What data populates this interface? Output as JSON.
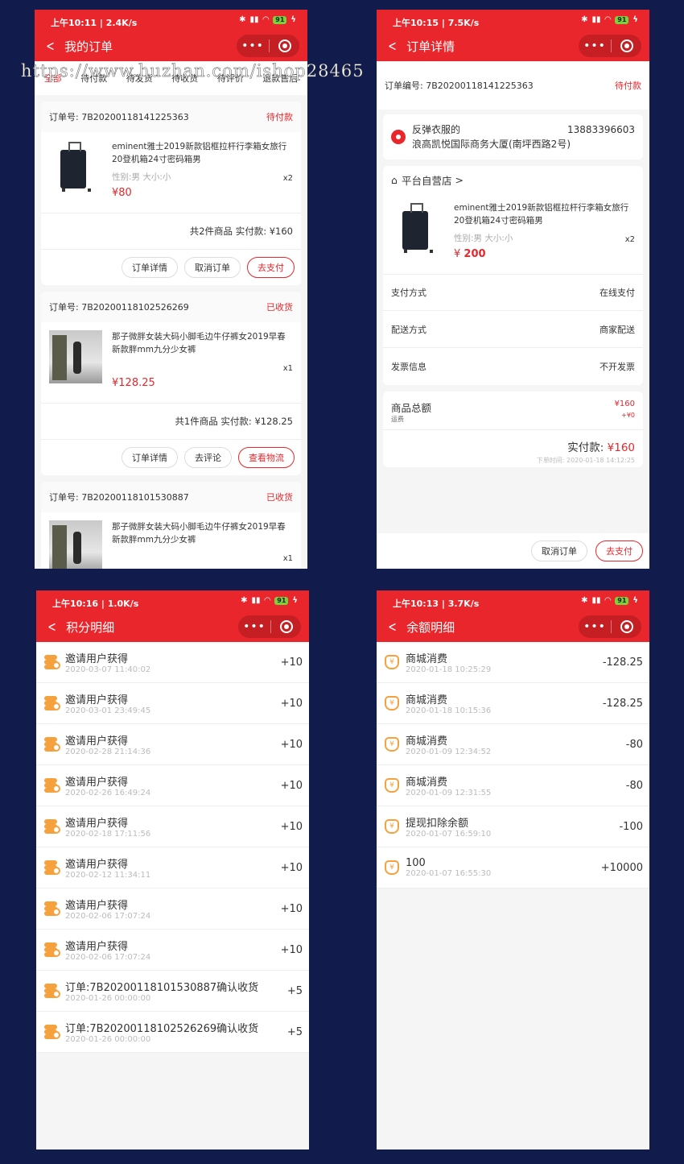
{
  "watermark": "https://www.huzhan.com/ishop28465",
  "colors": {
    "accent": "#e9262b",
    "background": "#111c4d",
    "coin": "#f5a13d"
  },
  "p1": {
    "status": {
      "time": "上午10:11 | 2.4K/s",
      "battery": "91"
    },
    "title": "我的订单",
    "tabs": [
      "全部",
      "待付款",
      "待发货",
      "待收货",
      "待评价",
      "退款售后"
    ],
    "orders": [
      {
        "no_label": "订单号:",
        "no": "7B20200118141225363",
        "status": "待付款",
        "name": "eminent雅士2019新款铝框拉杆行李箱女旅行20登机箱24寸密码箱男",
        "spec": "性别:男 大小:小",
        "price": "¥80",
        "qty": "x2",
        "summary": "共2件商品 实付款: ¥160",
        "buttons": [
          "订单详情",
          "取消订单",
          "去支付"
        ]
      },
      {
        "no_label": "订单号:",
        "no": "7B20200118102526269",
        "status": "已收货",
        "name": "那子微胖女装大码小脚毛边牛仔裤女2019早春新款胖mm九分少女裤",
        "spec": "",
        "price": "¥128.25",
        "qty": "x1",
        "summary": "共1件商品 实付款: ¥128.25",
        "buttons": [
          "订单详情",
          "去评论",
          "查看物流"
        ]
      },
      {
        "no_label": "订单号:",
        "no": "7B20200118101530887",
        "status": "已收货",
        "name": "那子微胖女装大码小脚毛边牛仔裤女2019早春新款胖mm九分少女裤",
        "qty": "x1"
      }
    ]
  },
  "p2": {
    "status": {
      "time": "上午10:15 | 7.5K/s",
      "battery": "91"
    },
    "title": "订单详情",
    "order_no": "订单编号: 7B20200118141225363",
    "order_status": "待付款",
    "receiver": "反弹衣服的",
    "phone": "13883396603",
    "address": "浪高凯悦国际商务大厦(南坪西路2号)",
    "shop": "平台自营店",
    "name": "eminent雅士2019新款铝框拉杆行李箱女旅行20登机箱24寸密码箱男",
    "spec": "性别:男 大小:小",
    "price_sym": "¥",
    "price": "200",
    "qty": "x2",
    "pay_label": "支付方式",
    "pay": "在线支付",
    "ship_label": "配送方式",
    "ship": "商家配送",
    "invoice_label": "发票信息",
    "invoice": "不开发票",
    "total_label": "商品总额",
    "total": "¥160",
    "freight_label": "运费",
    "freight": "+¥0",
    "paid_label": "实付款:",
    "paid": "¥160",
    "order_time": "下单时间: 2020-01-18 14:12:25",
    "buttons": [
      "取消订单",
      "去支付"
    ]
  },
  "p3": {
    "status": {
      "time": "上午10:16 | 1.0K/s",
      "battery": "91"
    },
    "title": "积分明细",
    "items": [
      {
        "t": "邀请用户获得",
        "d": "2020-03-07 11:40:02",
        "v": "+10"
      },
      {
        "t": "邀请用户获得",
        "d": "2020-03-01 23:49:45",
        "v": "+10"
      },
      {
        "t": "邀请用户获得",
        "d": "2020-02-28 21:14:36",
        "v": "+10"
      },
      {
        "t": "邀请用户获得",
        "d": "2020-02-26 16:49:24",
        "v": "+10"
      },
      {
        "t": "邀请用户获得",
        "d": "2020-02-18 17:11:56",
        "v": "+10"
      },
      {
        "t": "邀请用户获得",
        "d": "2020-02-12 11:34:11",
        "v": "+10"
      },
      {
        "t": "邀请用户获得",
        "d": "2020-02-06 17:07:24",
        "v": "+10"
      },
      {
        "t": "邀请用户获得",
        "d": "2020-02-06 17:07:24",
        "v": "+10"
      },
      {
        "t": "订单:7B20200118101530887确认收货",
        "d": "2020-01-26 00:00:00",
        "v": "+5"
      },
      {
        "t": "订单:7B20200118102526269确认收货",
        "d": "2020-01-26 00:00:00",
        "v": "+5"
      }
    ]
  },
  "p4": {
    "status": {
      "time": "上午10:13 | 3.7K/s",
      "battery": "91"
    },
    "title": "余额明细",
    "items": [
      {
        "t": "商城消费",
        "d": "2020-01-18 10:25:29",
        "v": "-128.25"
      },
      {
        "t": "商城消费",
        "d": "2020-01-18 10:15:36",
        "v": "-128.25"
      },
      {
        "t": "商城消费",
        "d": "2020-01-09 12:34:52",
        "v": "-80"
      },
      {
        "t": "商城消费",
        "d": "2020-01-09 12:31:55",
        "v": "-80"
      },
      {
        "t": "提现扣除余额",
        "d": "2020-01-07 16:59:10",
        "v": "-100"
      },
      {
        "t": "100",
        "d": "2020-01-07 16:55:30",
        "v": "+10000"
      }
    ]
  }
}
